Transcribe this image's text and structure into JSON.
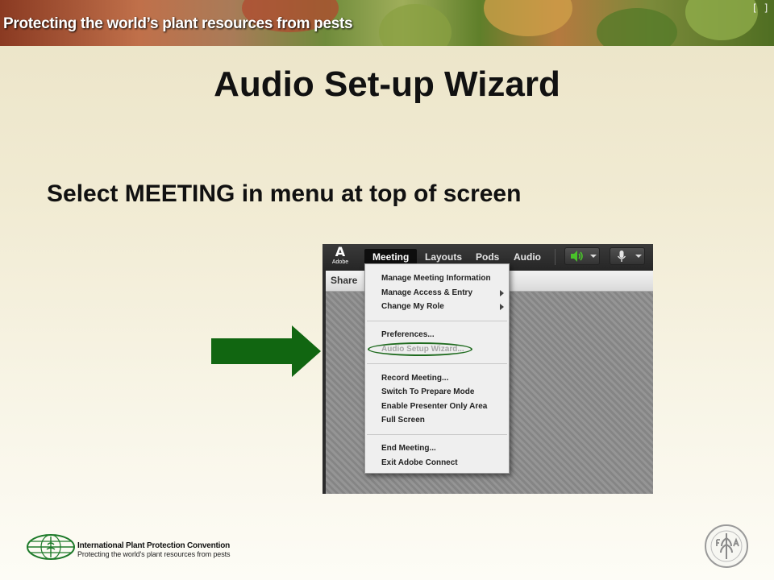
{
  "banner": {
    "title": "Protecting the world’s plant resources from pests",
    "corner": "[ ]"
  },
  "slide": {
    "title": "Audio Set-up Wizard",
    "instruction": "Select MEETING in menu at top of screen"
  },
  "app": {
    "logo_text": "Adobe",
    "menubar": [
      "Meeting",
      "Layouts",
      "Pods",
      "Audio"
    ],
    "active_menu": "Meeting",
    "pod_title": "Share",
    "dropdown": {
      "items": [
        {
          "label": "Manage Meeting Information",
          "submenu": false,
          "enabled": true
        },
        {
          "label": "Manage Access & Entry",
          "submenu": true,
          "enabled": true
        },
        {
          "label": "Change My Role",
          "submenu": true,
          "enabled": true
        },
        {
          "label": "Preferences...",
          "submenu": false,
          "enabled": true
        },
        {
          "label": "Audio Setup Wizard...",
          "submenu": false,
          "enabled": false,
          "highlighted": true
        },
        {
          "label": "Record Meeting...",
          "submenu": false,
          "enabled": true
        },
        {
          "label": "Switch To Prepare Mode",
          "submenu": false,
          "enabled": true
        },
        {
          "label": "Enable Presenter Only Area",
          "submenu": false,
          "enabled": true
        },
        {
          "label": "Full Screen",
          "submenu": false,
          "enabled": true
        },
        {
          "label": "End Meeting...",
          "submenu": false,
          "enabled": true
        },
        {
          "label": "Exit Adobe Connect",
          "submenu": false,
          "enabled": true
        }
      ]
    },
    "icons": [
      "speaker-icon",
      "microphone-icon"
    ]
  },
  "footer": {
    "org_name": "International Plant Protection Convention",
    "org_tagline": "Protecting the world's plant resources from pests"
  },
  "colors": {
    "arrow": "#116611",
    "highlight_ring": "#1f6b1f",
    "speaker": "#49c22a"
  }
}
